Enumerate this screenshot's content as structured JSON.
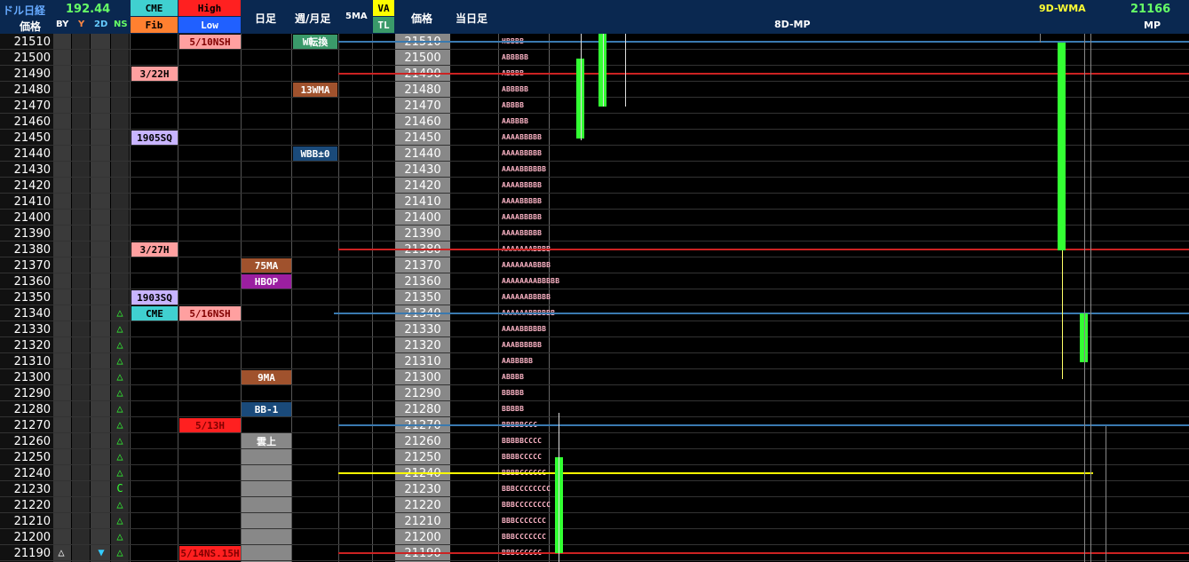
{
  "header": {
    "dollar_nikkei": "ドル日経",
    "dollar_nikkei_value": "192.44",
    "price_label": "価格",
    "by": "BY",
    "y": "Y",
    "two_d": "2D",
    "ns": "NS",
    "cme": "CME",
    "fib": "Fib",
    "high": "High",
    "low": "Low",
    "daily": "日足",
    "weekly_monthly": "週/月足",
    "five_ma": "5MA",
    "va": "VA",
    "tl": "TL",
    "price_label2": "価格",
    "today_bar": "当日足",
    "eight_d_mp": "8D-MP",
    "nine_d_wma": "9D-WMA",
    "mp_value": "21166",
    "mp": "MP"
  },
  "prices": [
    "21510",
    "21500",
    "21490",
    "21480",
    "21470",
    "21460",
    "21450",
    "21440",
    "21430",
    "21420",
    "21410",
    "21400",
    "21390",
    "21380",
    "21370",
    "21360",
    "21350",
    "21340",
    "21330",
    "21320",
    "21310",
    "21300",
    "21290",
    "21280",
    "21270",
    "21260",
    "21250",
    "21240",
    "21230",
    "21220",
    "21210",
    "21200",
    "21190"
  ],
  "cme_fib_labels": [
    {
      "row": 2,
      "text": "3/22H",
      "color": "#ffa0a0"
    },
    {
      "row": 6,
      "text": "1905SQ",
      "color": "#c8b4ff"
    },
    {
      "row": 13,
      "text": "3/27H",
      "color": "#ffa0a0"
    },
    {
      "row": 16,
      "text": "1903SQ",
      "color": "#c8b4ff"
    },
    {
      "row": 17,
      "text": "CME",
      "color": "#40d0d0"
    }
  ],
  "high_low_labels": [
    {
      "row": 0,
      "text": "5/10NSH",
      "color": "#ffa0a0",
      "fg": "#800000"
    },
    {
      "row": 17,
      "text": "5/16NSH",
      "color": "#ffa0a0",
      "fg": "#800000"
    },
    {
      "row": 24,
      "text": "5/13H",
      "color": "#ff2020",
      "fg": "#800000"
    },
    {
      "row": 32,
      "text": "5/14NS.15H",
      "color": "#ff2020",
      "fg": "#800000"
    }
  ],
  "daily_labels": [
    {
      "row": 14,
      "text": "75MA",
      "color": "#a0522d",
      "fg": "#ffffff"
    },
    {
      "row": 15,
      "text": "HBOP",
      "color": "#9b1fa0",
      "fg": "#ffffff"
    },
    {
      "row": 21,
      "text": "9MA",
      "color": "#a0522d",
      "fg": "#ffffff"
    },
    {
      "row": 23,
      "text": "BB-1",
      "color": "#1a4a7a",
      "fg": "#ffffff"
    },
    {
      "row": 25,
      "text": "雲上",
      "color": "#888888",
      "fg": "#ffffff"
    }
  ],
  "weekly_labels": [
    {
      "row": 0,
      "text": "W転換",
      "color": "#3a9a6a",
      "fg": "#ffffff"
    },
    {
      "row": 3,
      "text": "13WMA",
      "color": "#a0522d",
      "fg": "#ffffff"
    },
    {
      "row": 7,
      "text": "WBB±0",
      "color": "#1a4a7a",
      "fg": "#ffffff"
    }
  ],
  "ns_marks": [
    {
      "row": 17,
      "text": "△"
    },
    {
      "row": 18,
      "text": "△"
    },
    {
      "row": 19,
      "text": "△"
    },
    {
      "row": 20,
      "text": "△"
    },
    {
      "row": 21,
      "text": "△"
    },
    {
      "row": 22,
      "text": "△"
    },
    {
      "row": 23,
      "text": "△"
    },
    {
      "row": 24,
      "text": "△"
    },
    {
      "row": 25,
      "text": "△"
    },
    {
      "row": 26,
      "text": "△"
    },
    {
      "row": 27,
      "text": "△"
    },
    {
      "row": 28,
      "text": "C"
    },
    {
      "row": 29,
      "text": "△"
    },
    {
      "row": 30,
      "text": "△"
    },
    {
      "row": 31,
      "text": "△"
    },
    {
      "row": 32,
      "text": "△"
    }
  ],
  "by_mark": "△",
  "twod_mark": "▼",
  "tpo": [
    "HBBBB",
    "ABBBBB",
    "ABBBB",
    "ABBBBB",
    "ABBBB",
    "AABBBB",
    "AAAABBBBB",
    "AAAABBBBB",
    "AAAABBBBBB",
    "AAAABBBBB",
    "AAAABBBBB",
    "AAAABBBBB",
    "AAAABBBBB",
    "AAAAAAABBBB",
    "AAAAAAABBBB",
    "AAAAAAAABBBBB",
    "AAAAAABBBBB",
    "AAAAAABBBBBB",
    "AAAABBBBBB",
    "AAABBBBBB",
    "AABBBBB",
    "ABBBB",
    "BBBBB",
    "BBBBB",
    "BBBBBCCC",
    "BBBBBCCCC",
    "BBBBCCCCC",
    "BBBBCCCCCC",
    "BBBCCCCCCCC",
    "BBBCCCCCCCC",
    "BBBCCCCCCC",
    "BBBCCCCCCC",
    "BBBCCCCCC"
  ],
  "colors": {
    "header_bg": "#0a2850",
    "green": "#33ff33",
    "yellow_line": "#ffff00",
    "red_line": "#cc2222",
    "blue_line": "#3a7ab0"
  }
}
